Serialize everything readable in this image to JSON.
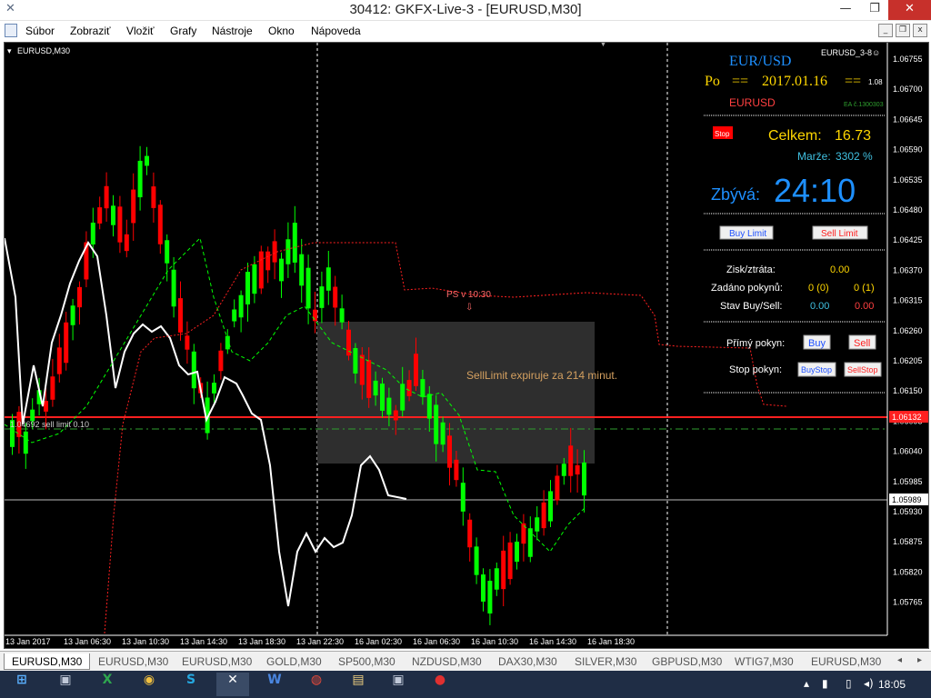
{
  "window": {
    "title": "30412: GKFX-Live-3 - [EURUSD,M30]"
  },
  "menu": [
    "Súbor",
    "Zobraziť",
    "Vložiť",
    "Grafy",
    "Nástroje",
    "Okno",
    "Nápoveda"
  ],
  "chart": {
    "symbol_label": "EURUSD,M30",
    "ea_label": "EURUSD_3-8☺",
    "price_axis": [
      "1.06755",
      "1.06700",
      "1.06645",
      "1.06590",
      "1.06535",
      "1.06480",
      "1.06425",
      "1.06370",
      "1.06315",
      "1.06260",
      "1.06205",
      "1.06150",
      "1.06095",
      "1.06040",
      "1.05985",
      "1.05930",
      "1.05875",
      "1.05820",
      "1.05765"
    ],
    "current_price": "1.05989",
    "red_line_price": "1.06132",
    "time_axis": [
      "13 Jan 2017",
      "13 Jan 06:30",
      "13 Jan 10:30",
      "13 Jan 14:30",
      "13 Jan 18:30",
      "13 Jan 22:30",
      "16 Jan 02:30",
      "16 Jan 06:30",
      "16 Jan 10:30",
      "16 Jan 14:30",
      "16 Jan 18:30"
    ],
    "sell_limit_label": "1.04692 sell limit 0.10",
    "ps_label": "PS v 10:30",
    "box_text": "SellLimit expiruje za 214 minut."
  },
  "panel": {
    "pair": "EUR/USD",
    "day": "Po",
    "eq1": "==",
    "date": "2017.01.16",
    "eq2": "==",
    "ver": "1.08",
    "symbol": "EURUSD",
    "ea_no": "EA č.1300303",
    "stop_button": "Stop",
    "total_label": "Celkem:",
    "total_value": "16.73",
    "margin_label": "Marže:",
    "margin_value": "3302 %",
    "remaining_label": "Zbývá:",
    "remaining_value": "24:10",
    "buy_limit": "Buy Limit",
    "sell_limit": "Sell Limit",
    "profit_label": "Zisk/ztráta:",
    "profit_value": "0.00",
    "orders_label": "Zadáno pokynů:",
    "orders_buy": "0 (0)",
    "orders_sell": "0 (1)",
    "state_label": "Stav Buy/Sell:",
    "state_buy": "0.00",
    "state_sell": "0.00",
    "direct_label": "Přímý pokyn:",
    "buy": "Buy",
    "sell": "Sell",
    "stop_label": "Stop pokyn:",
    "buystop": "BuyStop",
    "sellstop": "SellStop"
  },
  "tabs": [
    "EURUSD,M30",
    "EURUSD,M30",
    "EURUSD,M30",
    "GOLD,M30",
    "SP500,M30",
    "NZDUSD,M30",
    "DAX30,M30",
    "SILVER,M30",
    "GBPUSD,M30",
    "WTIG7,M30",
    "EURUSD,M30"
  ],
  "taskbar": {
    "time": "18:05"
  },
  "colors": {
    "bull": "#00ff00",
    "bear": "#ff0000",
    "accent_blue": "#1e90ff",
    "gold": "#ffd700"
  }
}
